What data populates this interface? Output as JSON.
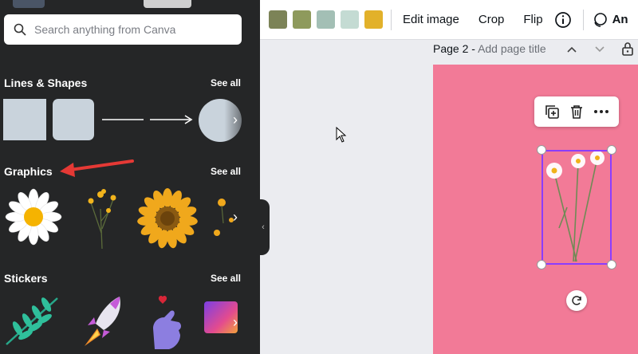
{
  "search": {
    "placeholder": "Search anything from Canva"
  },
  "sections": {
    "lines_shapes": {
      "title": "Lines & Shapes",
      "see_all": "See all"
    },
    "graphics": {
      "title": "Graphics",
      "see_all": "See all"
    },
    "stickers": {
      "title": "Stickers",
      "see_all": "See all"
    }
  },
  "toolbar": {
    "swatches": [
      "#7c8357",
      "#8e9a5c",
      "#a3bfb5",
      "#c4dbd3",
      "#e2b12a"
    ],
    "edit_image": "Edit image",
    "crop": "Crop",
    "flip": "Flip",
    "animate": "An"
  },
  "page_header": {
    "page": "Page 2 -",
    "title_placeholder": "Add page title"
  },
  "colors": {
    "panel_bg": "#252627",
    "canvas_bg": "#f27a97",
    "selection": "#8b3dff",
    "annotation_arrow": "#e53935"
  }
}
